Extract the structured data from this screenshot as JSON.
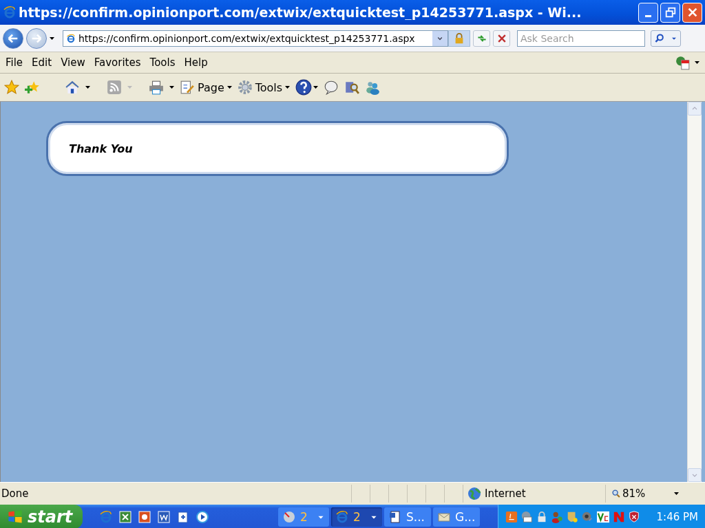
{
  "window": {
    "title": "https://confirm.opinionport.com/extwix/extquicktest_p14253771.aspx - Wi..."
  },
  "address_bar": {
    "url": "https://confirm.opinionport.com/extwix/extquicktest_p14253771.aspx"
  },
  "search": {
    "placeholder": "Ask Search"
  },
  "menu": [
    "File",
    "Edit",
    "View",
    "Favorites",
    "Tools",
    "Help"
  ],
  "toolbar_buttons": [
    {
      "label": "Page"
    },
    {
      "label": "Tools"
    }
  ],
  "page": {
    "heading": "Thank You"
  },
  "status_bar": {
    "status": "Done",
    "zone": "Internet",
    "zoom": "81%"
  },
  "taskbar": {
    "start": "start",
    "groups": [
      {
        "count": "2",
        "selected": false
      },
      {
        "count": "2",
        "selected": true
      }
    ],
    "windows": [
      {
        "label": "S...",
        "selected": false
      },
      {
        "label": "G...",
        "selected": false
      }
    ],
    "clock": "1:46 PM"
  }
}
